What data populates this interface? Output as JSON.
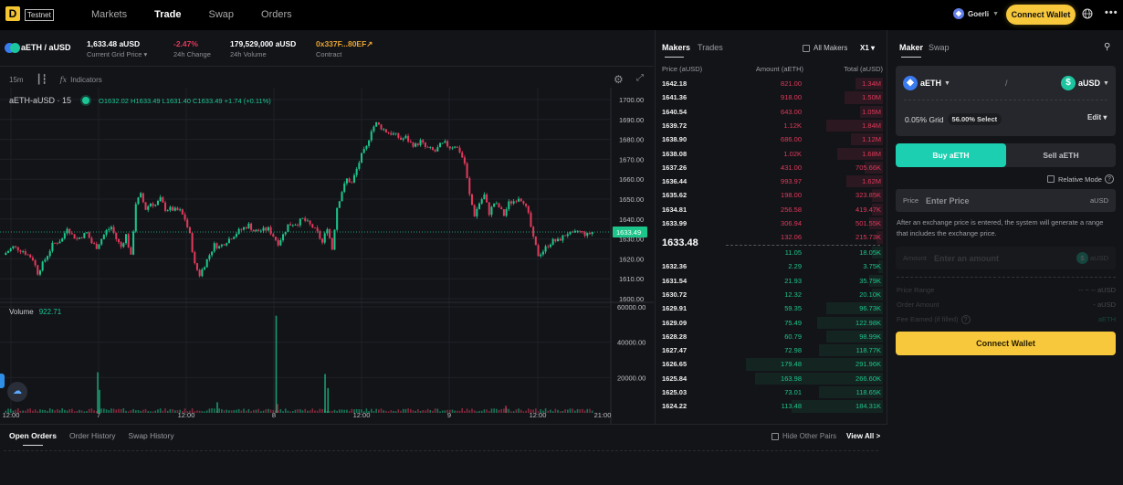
{
  "topbar": {
    "logo": "D",
    "env_badge": "Testnet",
    "nav": [
      {
        "label": "Markets",
        "active": false
      },
      {
        "label": "Trade",
        "active": true
      },
      {
        "label": "Swap",
        "active": false
      },
      {
        "label": "Orders",
        "active": false
      }
    ],
    "network": "Goerli",
    "connect_wallet": "Connect Wallet",
    "globe_icon": "🌐",
    "more_icon": "•••"
  },
  "pair_bar": {
    "pair": "aETH / aUSD",
    "stats": [
      {
        "value": "1,633.48 aUSD",
        "label": "Current Grid Price ▾",
        "color": "#ffffff"
      },
      {
        "value": "-2.47%",
        "label": "24h Change",
        "color": "#e0395b"
      },
      {
        "value": "179,529,000 aUSD",
        "label": "24h Volume",
        "color": "#ffffff"
      },
      {
        "value": "0x337F...80EF↗",
        "label": "Contract",
        "color": "#e8a533"
      }
    ]
  },
  "chart_toolbar": {
    "interval": "15m",
    "indicators": "Indicators"
  },
  "chart_legend": {
    "symbol": "aETH-aUSD · 15",
    "ohlc": "O1632.02 H1633.49 L1631.40 C1633.49 +1.74 (+0.11%)",
    "volume_label": "Volume",
    "volume_value": "922.71"
  },
  "chart_data": {
    "type": "candlestick",
    "symbol": "aETH-aUSD",
    "interval": "15",
    "price_axis": {
      "ticks": [
        "1700.00",
        "1690.00",
        "1680.00",
        "1670.00",
        "1660.00",
        "1650.00",
        "1640.00",
        "1630.00",
        "1620.00",
        "1610.00",
        "1600.00"
      ],
      "range": [
        1600,
        1700
      ]
    },
    "last_price": "1633.49",
    "volume_axis": {
      "ticks": [
        "60000.00",
        "40000.00",
        "20000.00"
      ],
      "range": [
        0,
        60000
      ]
    },
    "time_axis": {
      "ticks": [
        "12:00",
        "7",
        "12:00",
        "8",
        "12:00",
        "9",
        "12:00",
        "21:00"
      ]
    },
    "price_path": [
      [
        0,
        1622
      ],
      [
        2,
        1626
      ],
      [
        4,
        1624
      ],
      [
        6,
        1620
      ],
      [
        7,
        1613
      ],
      [
        9,
        1622
      ],
      [
        10,
        1627
      ],
      [
        12,
        1630
      ],
      [
        13,
        1636
      ],
      [
        14,
        1632
      ],
      [
        15,
        1630
      ],
      [
        17,
        1633
      ],
      [
        18,
        1628
      ],
      [
        19,
        1626
      ],
      [
        21,
        1634
      ],
      [
        22,
        1636
      ],
      [
        23,
        1630
      ],
      [
        24,
        1626
      ],
      [
        25,
        1632
      ],
      [
        26,
        1621
      ],
      [
        27,
        1648
      ],
      [
        28,
        1652
      ],
      [
        29,
        1645
      ],
      [
        30,
        1648
      ],
      [
        31,
        1647
      ],
      [
        32,
        1650
      ],
      [
        33,
        1645
      ],
      [
        34,
        1645
      ],
      [
        36,
        1644
      ],
      [
        37,
        1640
      ],
      [
        38,
        1632
      ],
      [
        39,
        1617
      ],
      [
        40,
        1612
      ],
      [
        41,
        1617
      ],
      [
        42,
        1622
      ],
      [
        43,
        1627
      ],
      [
        44,
        1626
      ],
      [
        46,
        1630
      ],
      [
        48,
        1634
      ],
      [
        50,
        1637
      ],
      [
        51,
        1634
      ],
      [
        52,
        1634
      ],
      [
        54,
        1635
      ],
      [
        56,
        1628
      ],
      [
        57,
        1632
      ],
      [
        58,
        1637
      ],
      [
        60,
        1638
      ],
      [
        61,
        1640
      ],
      [
        62,
        1638
      ],
      [
        63,
        1636
      ],
      [
        64,
        1633
      ],
      [
        65,
        1628
      ],
      [
        66,
        1636
      ],
      [
        67,
        1625
      ],
      [
        68,
        1646
      ],
      [
        69,
        1654
      ],
      [
        70,
        1660
      ],
      [
        71,
        1658
      ],
      [
        72,
        1665
      ],
      [
        73,
        1672
      ],
      [
        74,
        1676
      ],
      [
        75,
        1685
      ],
      [
        76,
        1688
      ],
      [
        77,
        1686
      ],
      [
        78,
        1684
      ],
      [
        79,
        1683
      ],
      [
        80,
        1682
      ],
      [
        81,
        1680
      ],
      [
        82,
        1681
      ],
      [
        83,
        1678
      ],
      [
        84,
        1677
      ],
      [
        85,
        1679
      ],
      [
        86,
        1676
      ],
      [
        87,
        1675
      ],
      [
        88,
        1674
      ],
      [
        89,
        1677
      ],
      [
        90,
        1678
      ],
      [
        91,
        1676
      ],
      [
        92,
        1677
      ],
      [
        93,
        1674
      ],
      [
        94,
        1668
      ],
      [
        95,
        1652
      ],
      [
        96,
        1642
      ],
      [
        97,
        1648
      ],
      [
        98,
        1652
      ],
      [
        99,
        1643
      ],
      [
        100,
        1648
      ],
      [
        101,
        1646
      ],
      [
        102,
        1642
      ],
      [
        103,
        1648
      ],
      [
        104,
        1649
      ],
      [
        105,
        1651
      ],
      [
        106,
        1649
      ],
      [
        107,
        1642
      ],
      [
        108,
        1630
      ],
      [
        109,
        1622
      ],
      [
        110,
        1624
      ],
      [
        111,
        1627
      ],
      [
        112,
        1629
      ],
      [
        113,
        1629
      ],
      [
        114,
        1631
      ],
      [
        115,
        1633
      ],
      [
        116,
        1632
      ],
      [
        117,
        1634
      ],
      [
        118,
        1633
      ],
      [
        119,
        1632
      ],
      [
        120,
        1633.5
      ]
    ],
    "volume_spikes": [
      {
        "x": 0.157,
        "value": 23000,
        "up": true
      },
      {
        "x": 0.16,
        "value": 13000,
        "up": true
      },
      {
        "x": 0.46,
        "value": 55000,
        "up": true
      },
      {
        "x": 0.462,
        "value": 5000,
        "up": false
      },
      {
        "x": 0.543,
        "value": 22000,
        "up": true
      },
      {
        "x": 0.548,
        "value": 14000,
        "up": true
      },
      {
        "x": 0.36,
        "value": 6000,
        "up": true
      },
      {
        "x": 0.85,
        "value": 4000,
        "up": false
      }
    ]
  },
  "orderbook": {
    "tabs": [
      {
        "label": "Makers",
        "active": true
      },
      {
        "label": "Trades",
        "active": false
      }
    ],
    "all_makers": "All Makers",
    "multiplier": "X1 ▾",
    "headers": {
      "price": "Price (aUSD)",
      "amount": "Amount (aETH)",
      "total": "Total (aUSD)"
    },
    "asks": [
      {
        "price": "1642.18",
        "amount": "821.00",
        "total": "1.34M",
        "depth": 0.12
      },
      {
        "price": "1641.36",
        "amount": "918.00",
        "total": "1.50M",
        "depth": 0.17
      },
      {
        "price": "1640.54",
        "amount": "643.00",
        "total": "1.05M",
        "depth": 0.1
      },
      {
        "price": "1639.72",
        "amount": "1.12K",
        "total": "1.84M",
        "depth": 0.25
      },
      {
        "price": "1638.90",
        "amount": "686.00",
        "total": "1.12M",
        "depth": 0.14
      },
      {
        "price": "1638.08",
        "amount": "1.02K",
        "total": "1.68M",
        "depth": 0.2
      },
      {
        "price": "1637.26",
        "amount": "431.00",
        "total": "705.66K",
        "depth": 0.08
      },
      {
        "price": "1636.44",
        "amount": "993.97",
        "total": "1.62M",
        "depth": 0.16
      },
      {
        "price": "1635.62",
        "amount": "198.00",
        "total": "323.85K",
        "depth": 0.05
      },
      {
        "price": "1634.81",
        "amount": "256.58",
        "total": "419.47K",
        "depth": 0.05
      },
      {
        "price": "1633.99",
        "amount": "306.94",
        "total": "501.55K",
        "depth": 0.06
      },
      {
        "price": "",
        "amount": "132.06",
        "total": "215.73K",
        "depth": 0.03
      }
    ],
    "mid_price": "1633.48",
    "bids": [
      {
        "price": "",
        "amount": "11.05",
        "total": "18.05K",
        "depth": 0.05
      },
      {
        "price": "1632.36",
        "amount": "2.29",
        "total": "3.75K",
        "depth": 0.02
      },
      {
        "price": "1631.54",
        "amount": "21.93",
        "total": "35.79K",
        "depth": 0.06
      },
      {
        "price": "1630.72",
        "amount": "12.32",
        "total": "20.10K",
        "depth": 0.05
      },
      {
        "price": "1629.91",
        "amount": "59.35",
        "total": "96.73K",
        "depth": 0.25
      },
      {
        "price": "1629.09",
        "amount": "75.49",
        "total": "122.98K",
        "depth": 0.29
      },
      {
        "price": "1628.28",
        "amount": "60.79",
        "total": "98.99K",
        "depth": 0.25
      },
      {
        "price": "1627.47",
        "amount": "72.98",
        "total": "118.77K",
        "depth": 0.28
      },
      {
        "price": "1626.65",
        "amount": "179.48",
        "total": "291.96K",
        "depth": 0.6
      },
      {
        "price": "1625.84",
        "amount": "163.98",
        "total": "266.60K",
        "depth": 0.56
      },
      {
        "price": "1625.03",
        "amount": "73.01",
        "total": "118.65K",
        "depth": 0.28
      },
      {
        "price": "1624.22",
        "amount": "113.48",
        "total": "184.31K",
        "depth": 0.4
      }
    ]
  },
  "bottom": {
    "tabs": [
      {
        "label": "Open Orders",
        "active": true
      },
      {
        "label": "Order History",
        "active": false
      },
      {
        "label": "Swap History",
        "active": false
      }
    ],
    "hide_other_pairs": "Hide Other Pairs",
    "view_all": "View All >"
  },
  "right_panel": {
    "tabs": [
      {
        "label": "Maker",
        "active": true
      },
      {
        "label": "Swap",
        "active": false
      }
    ],
    "base_token": "aETH",
    "quote_token": "aUSD",
    "separator": "/",
    "grid": "0.05% Grid",
    "select_pill": "56.00% Select",
    "edit": "Edit ▾",
    "buy_label": "Buy aETH",
    "sell_label": "Sell aETH",
    "relative_mode": "Relative Mode",
    "price_label": "Price",
    "price_placeholder": "Enter Price",
    "price_unit": "aUSD",
    "hint": "After an exchange price is entered, the system will generate a range that includes the exchange price.",
    "amount_label": "Amount",
    "amount_placeholder": "Enter an amount",
    "amount_unit": "aUSD",
    "price_range_label": "Price Range",
    "price_range_value": "-- ~ -- aUSD",
    "order_amount_label": "Order Amount",
    "order_amount_value": "- aUSD",
    "fee_label": "Fee Earned (if filled)",
    "fee_value": "aETH",
    "connect_wallet": "Connect Wallet"
  },
  "colors": {
    "up": "#1cc58a",
    "down": "#e0395b",
    "accent_yellow": "#f7c83c",
    "buy_teal": "#1ccfb0"
  }
}
